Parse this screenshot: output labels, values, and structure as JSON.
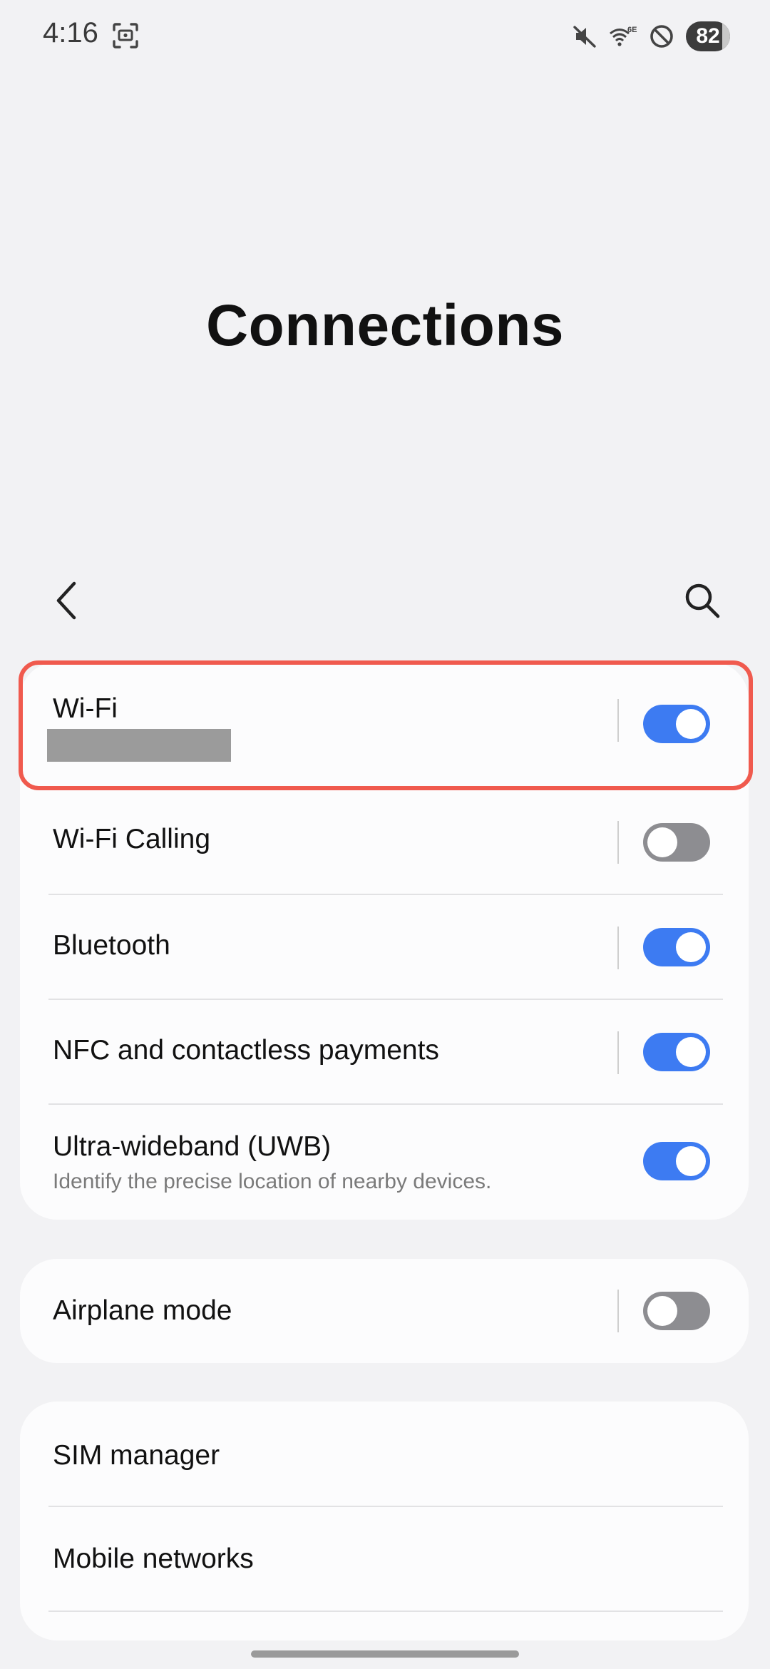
{
  "status_bar": {
    "time": "4:16",
    "battery": "82",
    "battery_level": 0.82,
    "icons": [
      "screenshot-icon",
      "mute-icon",
      "wifi-6e-icon",
      "do-not-disturb-icon",
      "battery-icon"
    ]
  },
  "header": {
    "title": "Connections"
  },
  "nav": {
    "back_icon": "chevron-left-icon",
    "search_icon": "search-icon"
  },
  "colors": {
    "toggle_on": "#3d7bf2",
    "toggle_off": "#8d8d91",
    "highlight": "#f05a4e",
    "background": "#f2f2f4",
    "card": "#fcfcfd"
  },
  "settings": {
    "wifi": {
      "title": "Wi-Fi",
      "enabled": true,
      "subtitle_redacted": true
    },
    "wifi_calling": {
      "title": "Wi-Fi Calling",
      "enabled": false
    },
    "bluetooth": {
      "title": "Bluetooth",
      "enabled": true
    },
    "nfc": {
      "title": "NFC and contactless payments",
      "enabled": true
    },
    "uwb": {
      "title": "Ultra-wideband (UWB)",
      "subtitle": "Identify the precise location of nearby devices.",
      "enabled": true
    },
    "airplane": {
      "title": "Airplane mode",
      "enabled": false
    },
    "sim_manager": {
      "title": "SIM manager"
    },
    "mobile_networks": {
      "title": "Mobile networks"
    }
  }
}
